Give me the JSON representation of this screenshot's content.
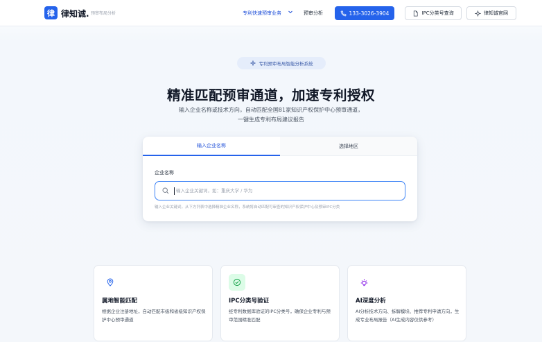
{
  "header": {
    "logo_char": "律",
    "brand": "律知诚.",
    "brand_sub": "预审布局分析",
    "nav": [
      "专利快速预审业务",
      "预审分析"
    ],
    "phone": "133-3026-3904",
    "ipc_button": "IPC分类号查询",
    "site_button": "律知诚官网"
  },
  "hero": {
    "pill": "专利预审布局智能分析系统",
    "title": "精准匹配预审通道，加速专利授权",
    "desc_line1": "输入企业名称或技术方向，自动匹配全国81家知识产权保护中心预审通道，",
    "desc_line2": "一键生成专利布局建议报告"
  },
  "search_card": {
    "tabs": [
      "输入企业名称",
      "选择地区"
    ],
    "active_tab": 0,
    "field_label": "企业名称",
    "input_value": "",
    "input_placeholder": "输入企业关键词，如：重庆大学 / 华为",
    "hint": "输入企业关键词，从下方列表中选择精准企业名称，系统将自动匹配可审查的知识产权保护中心及预审IPC分类"
  },
  "features": [
    {
      "icon": "map-pin-icon",
      "title": "属地智能匹配",
      "desc": "根据企业注册地址，自动匹配市级和省级知识产权保护中心预审通道"
    },
    {
      "icon": "check-circle-icon",
      "title": "IPC分类号验证",
      "desc": "经专利数据库验证的IPC分类号，确保企业专利与预审范围精准匹配"
    },
    {
      "icon": "sparkle-icon",
      "title": "AI深度分析",
      "desc": "AI分析技术方向、拆解模块、推荐专利申请方向，生成专业布局报告（AI生成内容仅供参考）"
    }
  ],
  "colors": {
    "primary": "#2563eb",
    "pill_bg": "#e5edfb",
    "green_bg": "#dcfce7",
    "green": "#16a34a",
    "purple": "#9333ea"
  }
}
